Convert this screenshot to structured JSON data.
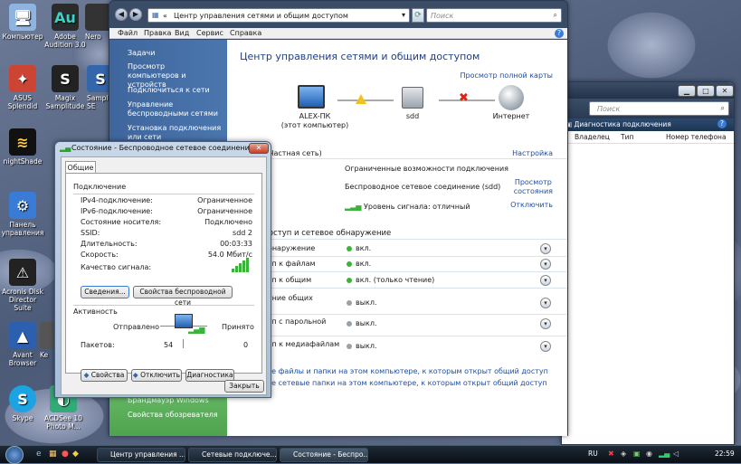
{
  "desktop": {
    "icons": [
      "Компьютер",
      "Adobe Audition 3.0",
      "Nero",
      "ASUS Splendid",
      "Magix Samplitude",
      "Sample SE",
      "nightShade",
      "Панель управления",
      "Acronis Disk Director Suite",
      "Avant Browser",
      "Ke",
      "Skype",
      "ACDSee 10 Photo M..."
    ]
  },
  "main": {
    "address": "Центр управления сетями и общим доступом",
    "address_prefix": "«",
    "search_placeholder": "Поиск",
    "menu": [
      "Файл",
      "Правка",
      "Вид",
      "Сервис",
      "Справка"
    ],
    "tasks_title": "Задачи",
    "tasks": [
      "Просмотр компьютеров и устройств",
      "Подключиться к сети",
      "Управление беспроводными сетями",
      "Установка подключения или сети"
    ],
    "bottom_tasks": [
      "Брандмауэр Windows",
      "Свойства обозревателя"
    ],
    "title": "Центр управления сетями и общим доступом",
    "view_map": "Просмотр полной карты",
    "map": {
      "pc": "ALEX-ПК",
      "pc_sub": "(этот компьютер)",
      "mid": "sdd",
      "net": "Интернет"
    },
    "network_label": "Частная сеть)",
    "network_cfg": "Настройка",
    "access_val": "Ограниченные возможности подключения",
    "conn_val": "Беспроводное сетевое соединение (sdd)",
    "conn_link": "Просмотр",
    "conn_link2": "состояния",
    "signal": "Уровень сигнала: отличный",
    "disconnect": "Отключить",
    "sharing_header": "доступ и сетевое обнаружение",
    "sharing": [
      {
        "label": "обнаружение",
        "value": "вкл.",
        "on": true
      },
      {
        "label": "туп к файлам",
        "value": "вкл.",
        "on": true
      },
      {
        "label": "туп к общим",
        "value": "вкл. (только чтение)",
        "on": true
      },
      {
        "label": "вание общих",
        "label2": "в",
        "value": "выкл.",
        "on": false
      },
      {
        "label": "туп с парольной",
        "value": "выкл.",
        "on": false
      },
      {
        "label": "туп к медиафайлам",
        "value": "выкл.",
        "on": false
      }
    ],
    "bottom_link1": "все файлы и папки на этом компьютере, к которым открыт общий доступ",
    "bottom_link2": "все сетевые папки на этом компьютере, к которым открыт общий доступ"
  },
  "back": {
    "search_placeholder": "Поиск",
    "breadcrumb": "Диагностика подключения",
    "columns": [
      "Владелец",
      "Тип",
      "Номер телефона"
    ]
  },
  "dialog": {
    "title": "Состояние - Беспроводное сетевое соединение",
    "tab": "Общие",
    "group_conn": "Подключение",
    "rows": [
      {
        "k": "IPv4-подключение:",
        "v": "Ограниченное"
      },
      {
        "k": "IPv6-подключение:",
        "v": "Ограниченное"
      },
      {
        "k": "Состояние носителя:",
        "v": "Подключено"
      },
      {
        "k": "SSID:",
        "v": "sdd 2"
      },
      {
        "k": "Длительность:",
        "v": "00:03:33"
      },
      {
        "k": "Скорость:",
        "v": "54.0 Мбит/с"
      }
    ],
    "signal_label": "Качество сигнала:",
    "btn_details": "Сведения...",
    "btn_wprops": "Свойства беспроводной сети",
    "group_activity": "Активность",
    "sent": "Отправлено",
    "received": "Принято",
    "packets_label": "Пакетов:",
    "packets_sent": "54",
    "packets_recv": "0",
    "btn_props": "Свойства",
    "btn_disconnect": "Отключить",
    "btn_diag": "Диагностика",
    "btn_close": "Закрыть"
  },
  "taskbar": {
    "items": [
      "Центр управления ...",
      "Сетевые подключе...",
      "Состояние - Беспро..."
    ],
    "lang": "RU",
    "clock": "22:59"
  },
  "colors": {
    "sidebar": "#4670a7",
    "accent_green": "#3bb33b",
    "title_blue": "#1f4fa4"
  }
}
